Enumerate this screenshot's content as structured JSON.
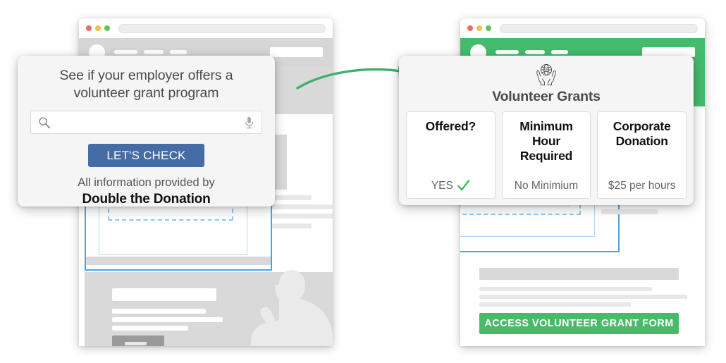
{
  "left_window": {
    "name": "employer-search-browser",
    "titlebar": {
      "dots": [
        "red",
        "yellow",
        "green"
      ],
      "url_value": ""
    },
    "navbar": {
      "style": "gray",
      "nav_items": 3
    },
    "popup": {
      "headline": "See if your employer offers a volunteer grant program",
      "search": {
        "value": "",
        "placeholder": "",
        "icon": "search-icon",
        "mic_icon": "microphone-icon"
      },
      "cta_label": "LET'S CHECK",
      "cta_color": "#456CA4",
      "provided_by_label": "All information provided by",
      "brand": "Double the Donation"
    }
  },
  "arrow": {
    "name": "green-flow-arrow",
    "color": "#3FAE6A"
  },
  "right_window": {
    "name": "volunteer-grants-browser",
    "titlebar": {
      "dots": [
        "red",
        "yellow",
        "green"
      ],
      "url_value": ""
    },
    "navbar": {
      "style": "green",
      "color": "#45BB6E",
      "nav_items": 3
    },
    "card": {
      "icon": "globe-in-hands-icon",
      "title": "Volunteer Grants",
      "tiles": [
        {
          "title": "Offered?",
          "value": "YES",
          "icon": "green-check-icon"
        },
        {
          "title": "Minimum Hour Required",
          "value": "No Minimium",
          "icon": ""
        },
        {
          "title": "Corporate Donation",
          "value": "$25 per hours",
          "icon": ""
        }
      ]
    },
    "cta": {
      "label": "ACCESS VOLUNTEER GRANT FORM",
      "color": "#49B96A"
    }
  }
}
